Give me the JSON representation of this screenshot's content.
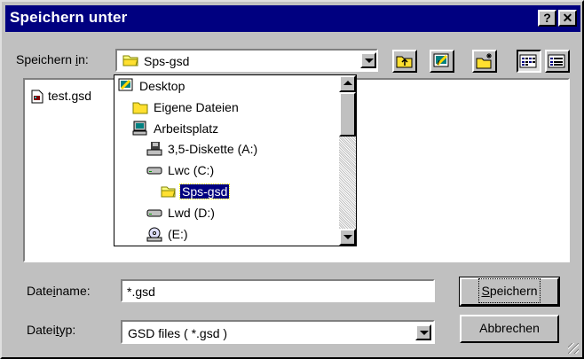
{
  "window": {
    "title": "Speichern unter",
    "help_label": "?",
    "close_label": "✕"
  },
  "save_in": {
    "label_pre": "Speichern ",
    "label_accel": "i",
    "label_post": "n:",
    "value": "Sps-gsd"
  },
  "toolbar": {
    "buttons": [
      "up-one-level",
      "desktop",
      "new-folder",
      "list-view",
      "details-view"
    ]
  },
  "file_list": {
    "items": [
      "test.gsd"
    ]
  },
  "location_dropdown": {
    "items": [
      {
        "label": "Desktop",
        "icon": "desktop-icon",
        "indent": 0
      },
      {
        "label": "Eigene Dateien",
        "icon": "folder-icon",
        "indent": 1
      },
      {
        "label": "Arbeitsplatz",
        "icon": "computer-icon",
        "indent": 1
      },
      {
        "label": "3,5-Diskette (A:)",
        "icon": "floppy-icon",
        "indent": 2
      },
      {
        "label": "Lwc (C:)",
        "icon": "drive-icon",
        "indent": 2
      },
      {
        "label": "Sps-gsd",
        "icon": "open-folder-icon",
        "indent": 3,
        "selected": true
      },
      {
        "label": "Lwd (D:)",
        "icon": "drive-icon",
        "indent": 2
      },
      {
        "label": "(E:)",
        "icon": "cdrom-icon",
        "indent": 2
      }
    ]
  },
  "filename": {
    "label_pre": "Date",
    "label_accel": "i",
    "label_post": "name:",
    "value": "*.gsd"
  },
  "filetype": {
    "label_pre": "Datei",
    "label_accel": "t",
    "label_post": "yp:",
    "value": "GSD files ( *.gsd )"
  },
  "buttons": {
    "save_accel": "S",
    "save_rest": "peichern",
    "cancel": "Abbrechen"
  },
  "colors": {
    "titlebar": "#000080",
    "face": "#c0c0c0",
    "selection": "#000080"
  }
}
